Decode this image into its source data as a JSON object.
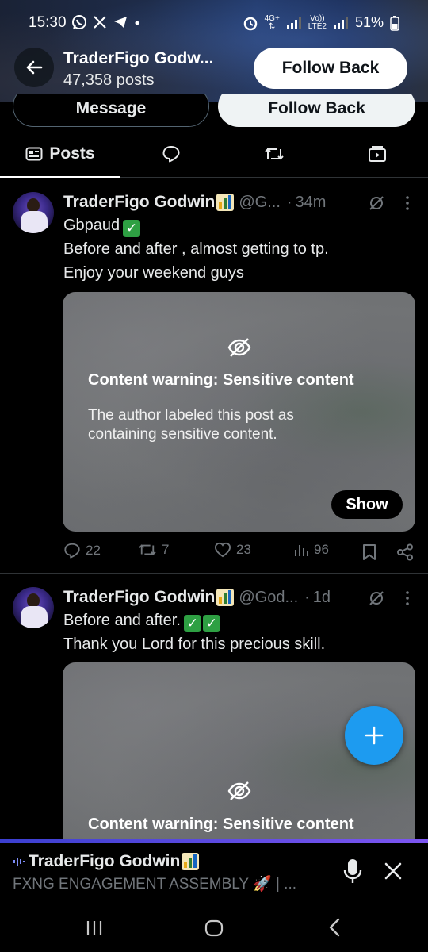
{
  "status_bar": {
    "time": "15:30",
    "left_icons": [
      "whatsapp-icon",
      "x-icon",
      "telegram-icon",
      "dot"
    ],
    "network_label_top": "4G+",
    "network_label_mid": "Vo))",
    "network_label_bottom": "LTE2",
    "battery": "51%"
  },
  "profile_header": {
    "name": "TraderFigo Godw...",
    "posts_count": "47,358 posts",
    "follow_back_label": "Follow Back"
  },
  "profile_actions": {
    "message_label": "Message",
    "follow_back_label": "Follow Back"
  },
  "tabs": {
    "posts_label": "Posts"
  },
  "posts": [
    {
      "author": "TraderFigo Godwin",
      "handle": "@G...",
      "time": "34m",
      "lines": [
        "Gbpaud",
        "Before and after , almost getting to tp.",
        "Enjoy your weekend guys"
      ],
      "content_warning": {
        "title": "Content warning: Sensitive content",
        "description": "The author labeled this post as containing sensitive content.",
        "show_label": "Show"
      },
      "stats": {
        "replies": "22",
        "reposts": "7",
        "likes": "23",
        "views": "96"
      }
    },
    {
      "author": "TraderFigo Godwin",
      "handle": "@God...",
      "time": "1d",
      "lines": [
        "Before and after.",
        "Thank you Lord for this precious skill."
      ],
      "content_warning": {
        "title": "Content warning: Sensitive content"
      }
    }
  ],
  "spaces_bar": {
    "host": "TraderFigo Godwin",
    "title": "FXNG ENGAGEMENT ASSEMBLY 🚀 | ..."
  },
  "colors": {
    "accent": "#1d9bf0",
    "background": "#000000",
    "muted_text": "#71767b",
    "divider": "#2f3336",
    "check_green": "#2ea043"
  }
}
